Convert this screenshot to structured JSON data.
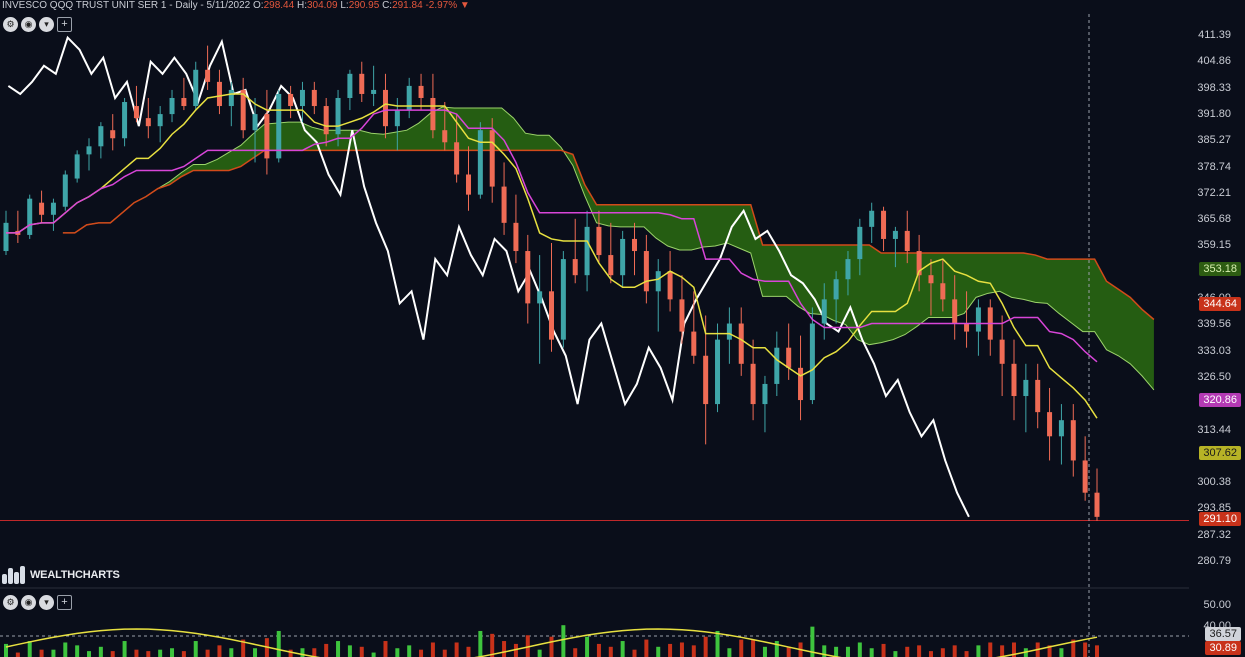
{
  "header": {
    "symbol": "INVESCO QQQ TRUST UNIT SER 1",
    "interval": "- Daily",
    "date": "- 5/11/2022",
    "open_label": "O:",
    "open": "298.44",
    "high_label": "H:",
    "high": "304.09",
    "low_label": "L:",
    "low": "290.95",
    "close_label": "C:",
    "close": "291.84",
    "change": "-2.97%",
    "change_arrow": "▼"
  },
  "brand": {
    "name": "WEALTHCHARTS"
  },
  "colors": {
    "background": "#0a0e1a",
    "up_candle": "#3fa5a8",
    "down_candle": "#ef6b55",
    "cloud_fill": "#2a6b12",
    "senkou_a": "#9bd36a",
    "senkou_b": "#d24a1a",
    "tenkan": "#e7e040",
    "kijun": "#d845d8",
    "chikou": "#ffffff",
    "price_line": "#c0282a"
  },
  "axis": {
    "ticks": [
      "411.39",
      "404.86",
      "398.33",
      "391.80",
      "385.27",
      "378.74",
      "372.21",
      "365.68",
      "359.15",
      "346.09",
      "339.56",
      "333.03",
      "326.50",
      "313.44",
      "300.38",
      "293.85",
      "287.32",
      "280.79"
    ],
    "tags": [
      {
        "label": "353.18",
        "bg": "#2d5c12",
        "fg": "#d8f0b0",
        "value": 353.18
      },
      {
        "label": "344.64",
        "bg": "#c8321a",
        "fg": "#ffffff",
        "value": 344.64
      },
      {
        "label": "320.86",
        "bg": "#b43ab4",
        "fg": "#ffffff",
        "value": 320.86
      },
      {
        "label": "307.62",
        "bg": "#b7b326",
        "fg": "#1a1a1a",
        "value": 307.62
      },
      {
        "label": "291.10",
        "bg": "#c8321a",
        "fg": "#ffffff",
        "value": 291.1
      }
    ]
  },
  "oscillator": {
    "ticks": [
      "50.00",
      "40.00"
    ],
    "tags": [
      {
        "label": "36.57",
        "bg": "#d0d3da",
        "fg": "#1a1a1a"
      },
      {
        "label": "30.89",
        "bg": "#c8321a",
        "fg": "#ffffff"
      }
    ]
  },
  "chart_data": {
    "type": "candlestick",
    "ylim": [
      280.79,
      411.39
    ],
    "series": [
      {
        "name": "QQQ",
        "ohlc": [
          [
            358,
            368,
            357,
            365
          ],
          [
            363,
            368,
            360,
            362
          ],
          [
            362,
            372,
            361,
            371
          ],
          [
            370,
            373,
            365,
            367
          ],
          [
            367,
            371,
            363,
            370
          ],
          [
            369,
            378,
            368,
            377
          ],
          [
            376,
            383,
            375,
            382
          ],
          [
            382,
            386,
            378,
            384
          ],
          [
            384,
            390,
            381,
            389
          ],
          [
            388,
            392,
            383,
            386
          ],
          [
            386,
            396,
            384,
            395
          ],
          [
            394,
            399,
            390,
            391
          ],
          [
            391,
            396,
            386,
            389
          ],
          [
            389,
            394,
            385,
            392
          ],
          [
            392,
            398,
            390,
            396
          ],
          [
            396,
            401,
            393,
            394
          ],
          [
            394,
            405,
            393,
            403
          ],
          [
            403,
            409,
            398,
            400
          ],
          [
            400,
            403,
            392,
            394
          ],
          [
            394,
            400,
            389,
            398
          ],
          [
            398,
            401,
            386,
            388
          ],
          [
            388,
            396,
            380,
            392
          ],
          [
            392,
            398,
            377,
            381
          ],
          [
            381,
            398,
            380,
            397
          ],
          [
            397,
            399,
            391,
            394
          ],
          [
            394,
            400,
            390,
            398
          ],
          [
            398,
            400,
            392,
            394
          ],
          [
            394,
            396,
            384,
            387
          ],
          [
            387,
            398,
            384,
            396
          ],
          [
            396,
            403,
            393,
            402
          ],
          [
            402,
            405,
            395,
            397
          ],
          [
            397,
            404,
            394,
            398
          ],
          [
            398,
            402,
            386,
            389
          ],
          [
            389,
            396,
            383,
            393
          ],
          [
            393,
            401,
            391,
            399
          ],
          [
            399,
            402,
            393,
            396
          ],
          [
            396,
            402,
            386,
            388
          ],
          [
            388,
            395,
            383,
            385
          ],
          [
            385,
            392,
            375,
            377
          ],
          [
            377,
            384,
            368,
            372
          ],
          [
            372,
            390,
            371,
            388
          ],
          [
            388,
            391,
            370,
            374
          ],
          [
            374,
            380,
            362,
            365
          ],
          [
            365,
            372,
            355,
            358
          ],
          [
            358,
            362,
            340,
            345
          ],
          [
            345,
            357,
            330,
            348
          ],
          [
            348,
            360,
            333,
            336
          ],
          [
            336,
            358,
            334,
            356
          ],
          [
            356,
            366,
            350,
            352
          ],
          [
            352,
            368,
            348,
            364
          ],
          [
            364,
            368,
            355,
            357
          ],
          [
            357,
            365,
            350,
            352
          ],
          [
            352,
            363,
            349,
            361
          ],
          [
            361,
            365,
            352,
            358
          ],
          [
            358,
            362,
            345,
            348
          ],
          [
            348,
            356,
            338,
            353
          ],
          [
            353,
            358,
            343,
            346
          ],
          [
            346,
            352,
            335,
            338
          ],
          [
            338,
            348,
            330,
            332
          ],
          [
            332,
            342,
            310,
            320
          ],
          [
            320,
            340,
            318,
            336
          ],
          [
            336,
            344,
            330,
            340
          ],
          [
            340,
            344,
            327,
            330
          ],
          [
            330,
            336,
            316,
            320
          ],
          [
            320,
            327,
            313,
            325
          ],
          [
            325,
            338,
            322,
            334
          ],
          [
            334,
            340,
            326,
            329
          ],
          [
            329,
            337,
            316,
            321
          ],
          [
            321,
            344,
            320,
            340
          ],
          [
            340,
            350,
            336,
            346
          ],
          [
            346,
            353,
            340,
            351
          ],
          [
            351,
            358,
            347,
            356
          ],
          [
            356,
            366,
            352,
            364
          ],
          [
            364,
            370,
            360,
            368
          ],
          [
            368,
            369,
            358,
            361
          ],
          [
            361,
            364,
            354,
            363
          ],
          [
            363,
            368,
            355,
            358
          ],
          [
            358,
            362,
            348,
            352
          ],
          [
            352,
            356,
            342,
            350
          ],
          [
            350,
            356,
            343,
            346
          ],
          [
            346,
            352,
            336,
            340
          ],
          [
            340,
            348,
            334,
            338
          ],
          [
            338,
            346,
            332,
            344
          ],
          [
            344,
            346,
            332,
            336
          ],
          [
            336,
            342,
            322,
            330
          ],
          [
            330,
            336,
            316,
            322
          ],
          [
            322,
            330,
            313,
            326
          ],
          [
            326,
            330,
            314,
            318
          ],
          [
            318,
            324,
            306,
            312
          ],
          [
            312,
            320,
            305,
            316
          ],
          [
            316,
            320,
            302,
            306
          ],
          [
            306,
            312,
            296,
            298
          ],
          [
            298,
            304,
            291,
            292
          ]
        ]
      }
    ],
    "price_level": 291.1
  }
}
